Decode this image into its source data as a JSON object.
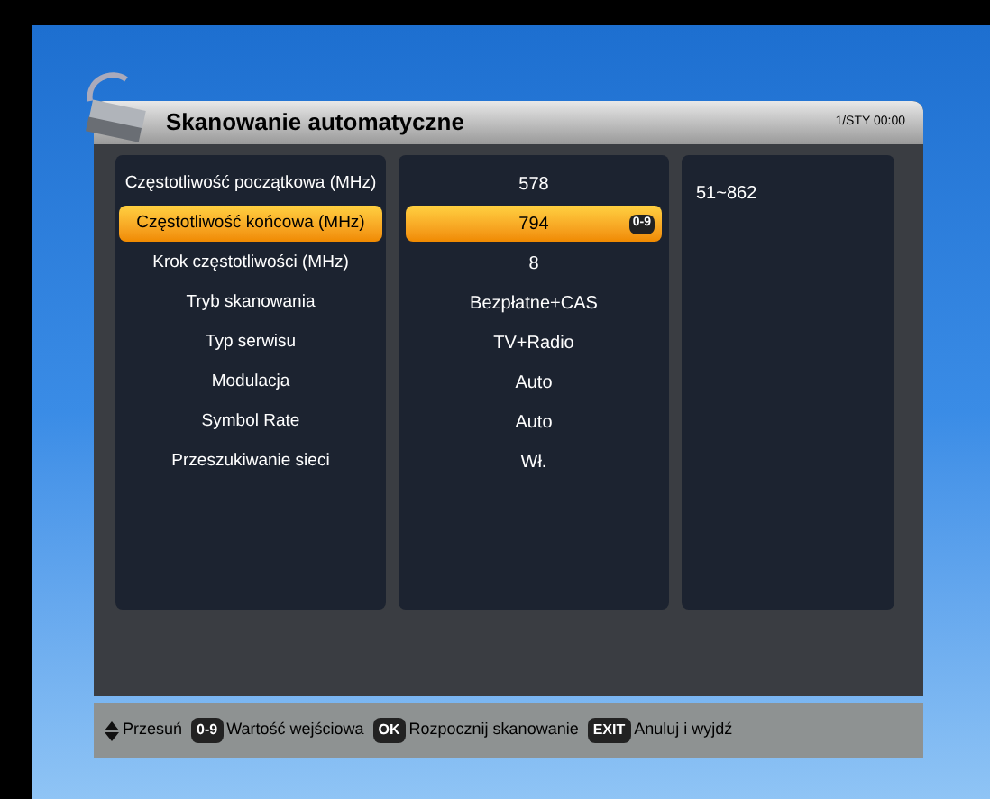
{
  "header": {
    "title": "Skanowanie automatyczne",
    "datetime": "1/STY 00:00"
  },
  "rows": [
    {
      "label": "Częstotliwość początkowa (MHz)",
      "value": "578",
      "selected": false
    },
    {
      "label": "Częstotliwość końcowa (MHz)",
      "value": "794",
      "selected": true,
      "key_hint": "0-9"
    },
    {
      "label": "Krok częstotliwości (MHz)",
      "value": "8",
      "selected": false
    },
    {
      "label": "Tryb skanowania",
      "value": "Bezpłatne+CAS",
      "selected": false
    },
    {
      "label": "Typ serwisu",
      "value": "TV+Radio",
      "selected": false
    },
    {
      "label": "Modulacja",
      "value": "Auto",
      "selected": false
    },
    {
      "label": "Symbol Rate",
      "value": "Auto",
      "selected": false
    },
    {
      "label": "Przeszukiwanie sieci",
      "value": "Wł.",
      "selected": false
    }
  ],
  "info": {
    "range": "51~862"
  },
  "footer": [
    {
      "kind": "arrows",
      "label": "Przesuń"
    },
    {
      "kind": "key",
      "key": "0-9",
      "label": "Wartość wejściowa"
    },
    {
      "kind": "key",
      "key": "OK",
      "label": "Rozpocznij skanowanie"
    },
    {
      "kind": "key",
      "key": "EXIT",
      "label": "Anuluj i wyjdź"
    }
  ]
}
